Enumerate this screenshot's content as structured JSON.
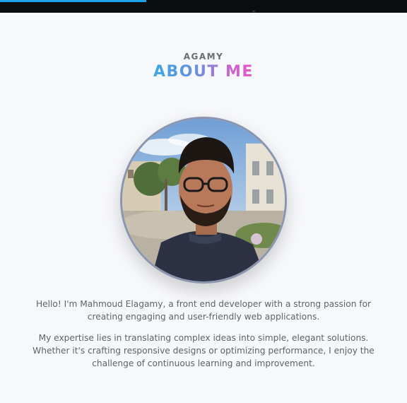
{
  "header": {
    "progress_fraction": 0.36
  },
  "about": {
    "kicker": "AGAMY",
    "title": "ABOUT ME",
    "title_gradient": [
      "#3ba7e6",
      "#e757c4"
    ],
    "portrait_alt": "Photo of Mahmoud Elagamy",
    "paragraph1": "Hello! I'm Mahmoud Elagamy, a front end developer with a strong passion for creating engaging and user-friendly web applications.",
    "paragraph2": "My expertise lies in translating complex ideas into simple, elegant solutions. Whether it's crafting responsive designs or optimizing performance, I enjoy the challenge of continuous learning and improvement."
  },
  "colors": {
    "background": "#f7f8fb",
    "topbar": "#0b0c0e",
    "progress": "#1aa3e8",
    "text": "#5e6268"
  }
}
